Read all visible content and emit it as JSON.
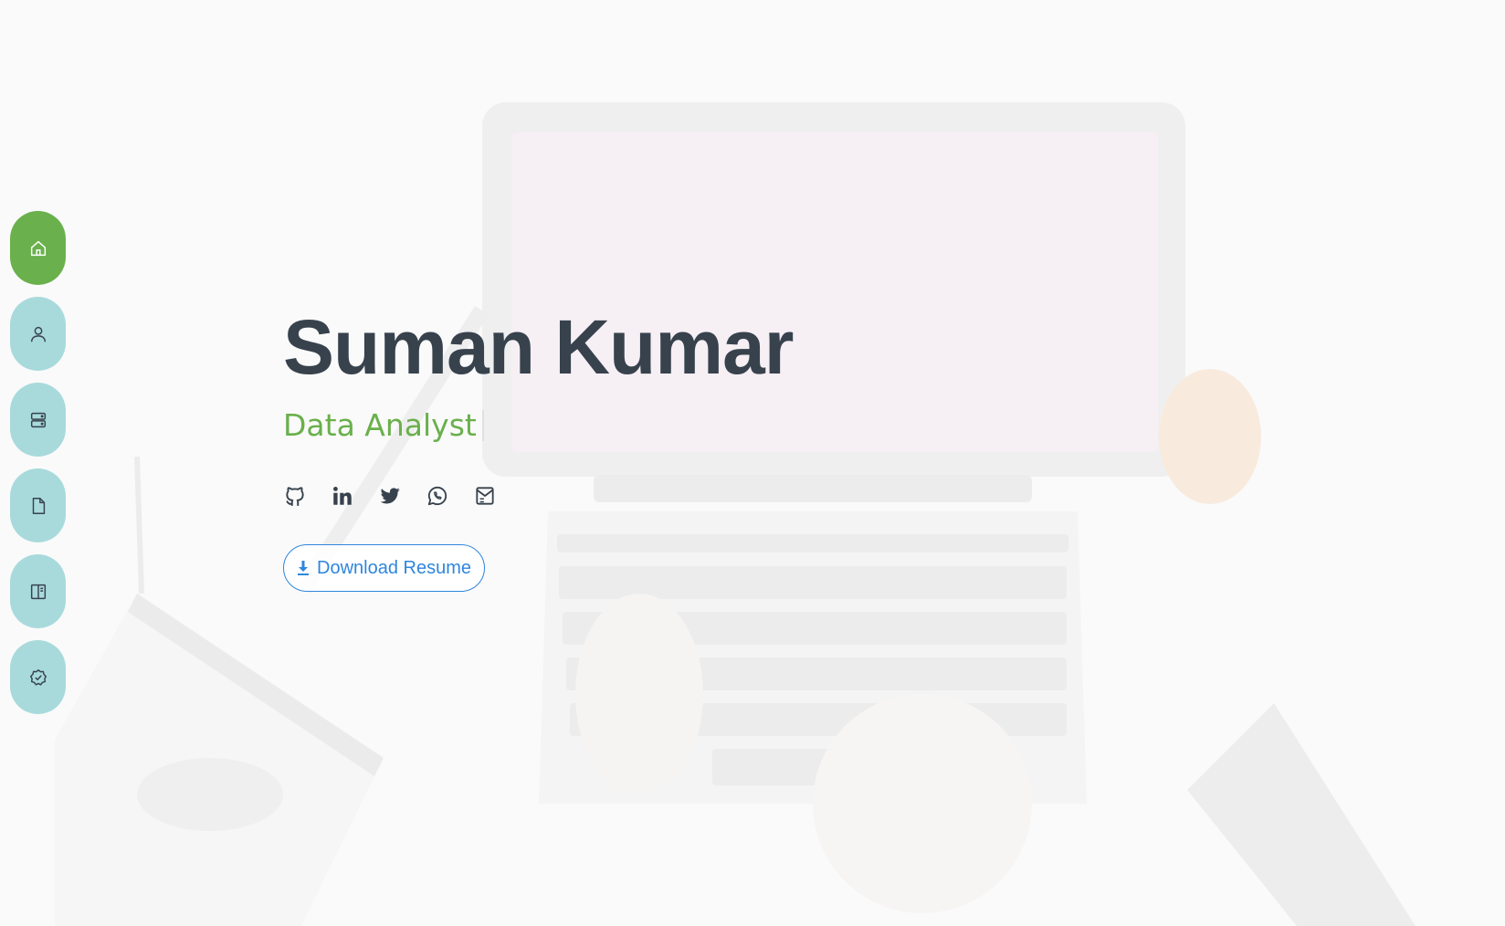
{
  "hero": {
    "name": "Suman Kumar",
    "role": "Data Analyst",
    "resume_label": "Download Resume"
  },
  "nav": {
    "items": [
      {
        "icon": "home-icon",
        "active": true
      },
      {
        "icon": "user-icon",
        "active": false
      },
      {
        "icon": "server-icon",
        "active": false
      },
      {
        "icon": "file-icon",
        "active": false
      },
      {
        "icon": "book-icon",
        "active": false
      },
      {
        "icon": "badge-check-icon",
        "active": false
      }
    ]
  },
  "socials": [
    {
      "icon": "github-icon"
    },
    {
      "icon": "linkedin-icon"
    },
    {
      "icon": "twitter-icon"
    },
    {
      "icon": "whatsapp-icon"
    },
    {
      "icon": "mail-icon"
    }
  ],
  "colors": {
    "accent_green": "#6ab04c",
    "nav_teal": "#a8dadc",
    "name_dark": "#37424d",
    "link_blue": "#2e86de"
  }
}
